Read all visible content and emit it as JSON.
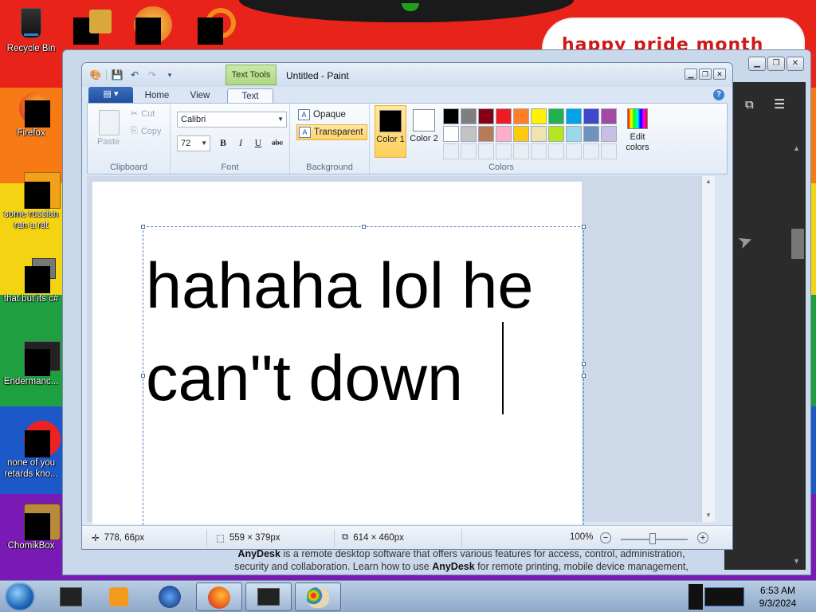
{
  "desktop": {
    "banner_text": "happy pride month",
    "wallpaper_colors": [
      "#e8231a",
      "#f77a14",
      "#f4d312",
      "#1fa040",
      "#1c58c8",
      "#7a1ab5"
    ],
    "icons": [
      {
        "label": "Recycle Bin"
      },
      {
        "label": "Firefox"
      },
      {
        "label": "some russian ran a rat"
      },
      {
        "label": "that but its c#"
      },
      {
        "label": "Endermanc..."
      },
      {
        "label": "none of you retards kno..."
      },
      {
        "label": "ChomikBox"
      }
    ]
  },
  "back_window": {
    "footer_line1_brand": "AnyDesk",
    "footer_line1_rest": " is a remote desktop software that offers various features for access, control, administration,",
    "footer_line2_start": "security and collaboration. Learn how to use ",
    "footer_line2_brand": "AnyDesk",
    "footer_line2_rest": " for remote printing, mobile device management,"
  },
  "paint": {
    "title": "Untitled - Paint",
    "context_tab": "Text Tools",
    "tabs": {
      "home": "Home",
      "view": "View",
      "text": "Text"
    },
    "clipboard": {
      "paste": "Paste",
      "cut": "Cut",
      "copy": "Copy",
      "group": "Clipboard"
    },
    "font": {
      "family": "Calibri",
      "size": "72",
      "bold": "B",
      "italic": "I",
      "underline": "U",
      "strike": "abc",
      "group": "Font"
    },
    "background": {
      "opaque": "Opaque",
      "transparent": "Transparent",
      "group": "Background",
      "selected": "transparent"
    },
    "colors": {
      "color1_label": "Color 1",
      "color2_label": "Color 2",
      "color1": "#000000",
      "color2": "#ffffff",
      "edit": "Edit colors",
      "group": "Colors",
      "palette_row1": [
        "#000000",
        "#7f7f7f",
        "#880015",
        "#ed1c24",
        "#ff7f27",
        "#fff200",
        "#22b14c",
        "#00a2e8",
        "#3f48cc",
        "#a349a4"
      ],
      "palette_row2": [
        "#ffffff",
        "#c3c3c3",
        "#b97a57",
        "#ffaec9",
        "#ffc90e",
        "#efe4b0",
        "#b5e61d",
        "#99d9ea",
        "#7092be",
        "#c8bfe7"
      ]
    },
    "canvas_text_line1": "hahaha lol he",
    "canvas_text_line2": "can\"t down",
    "status": {
      "cursor": "778, 66px",
      "selection": "559 × 379px",
      "canvas_size": "614 × 460px",
      "zoom": "100%"
    }
  },
  "taskbar": {
    "time": "6:53 AM",
    "date": "9/3/2024"
  }
}
